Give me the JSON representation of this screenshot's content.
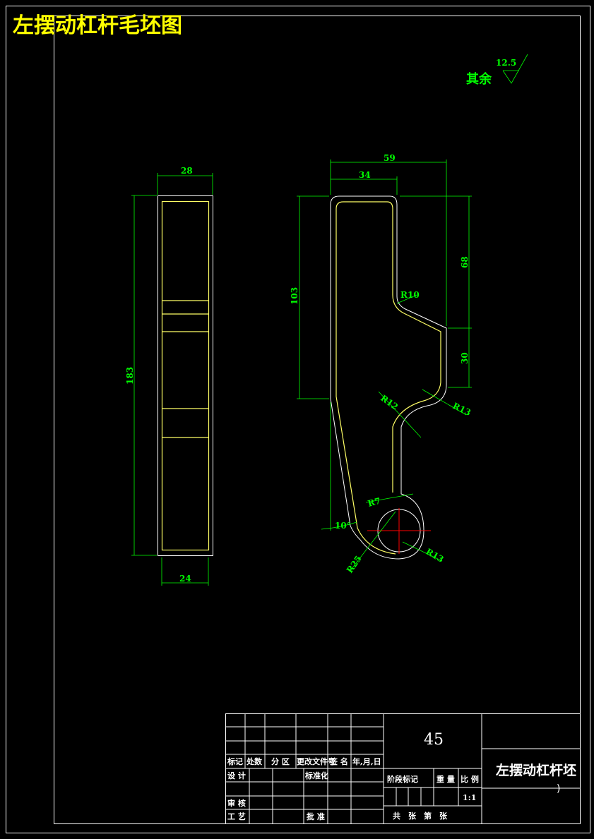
{
  "title": "左摆动杠杆毛坯图",
  "roughness": {
    "label": "其余",
    "value": "12.5"
  },
  "side_view": {
    "width_top": "28",
    "width_bottom": "24",
    "height": "183"
  },
  "front_view": {
    "dim_59": "59",
    "dim_34": "34",
    "dim_68": "68",
    "dim_30": "30",
    "dim_103": "103",
    "r10": "R10",
    "r12": "R12",
    "r13a": "R13",
    "r7": "R7",
    "r25": "R25",
    "r13b": "R13",
    "angle": "10°"
  },
  "title_block": {
    "material": "45",
    "part_name": "左摆动杠杆坯",
    "part_name_tail": ")",
    "headers": {
      "mark": "标记",
      "count": "处数",
      "zone": "分 区",
      "doc": "更改文件号",
      "sign": "签 名",
      "date": "年,月,日"
    },
    "design": "设 计",
    "standardize": "标准化",
    "review": "审 核",
    "craft": "工 艺",
    "approve": "批 准",
    "stage_mark": "阶段标记",
    "weight": "重 量",
    "scale_label": "比 例",
    "scale": "1:1",
    "sheets": "共　张　第　张"
  },
  "colors": {
    "frame": "#ffffff",
    "part": "#ffff66",
    "dim": "#00ff00",
    "title": "#ffff00",
    "center": "#ff0000"
  }
}
